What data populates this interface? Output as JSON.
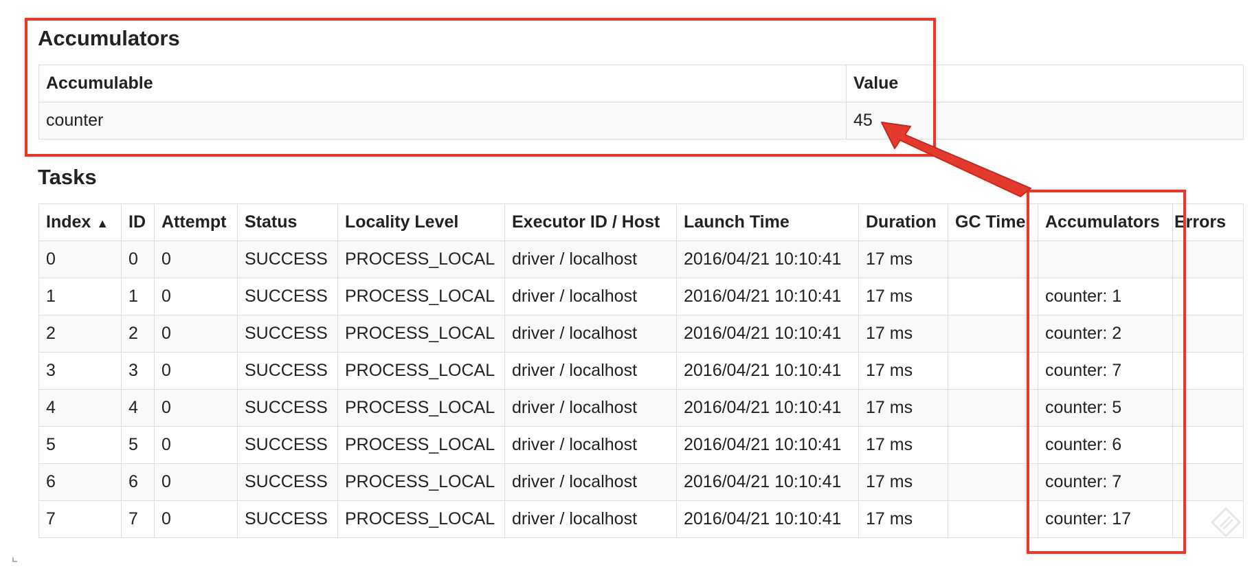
{
  "accumulators_section": {
    "title": "Accumulators",
    "columns": [
      "Accumulable",
      "Value"
    ],
    "rows": [
      {
        "name": "counter",
        "value": "45"
      }
    ]
  },
  "tasks_section": {
    "title": "Tasks",
    "sort_indicator": "▲",
    "columns": [
      "Index",
      "ID",
      "Attempt",
      "Status",
      "Locality Level",
      "Executor ID / Host",
      "Launch Time",
      "Duration",
      "GC Time",
      "Accumulators",
      "Errors"
    ],
    "rows": [
      {
        "index": "0",
        "id": "0",
        "attempt": "0",
        "status": "SUCCESS",
        "locality": "PROCESS_LOCAL",
        "executor": "driver / localhost",
        "launch": "2016/04/21 10:10:41",
        "duration": "17 ms",
        "gc": "",
        "accumulators": "",
        "errors": ""
      },
      {
        "index": "1",
        "id": "1",
        "attempt": "0",
        "status": "SUCCESS",
        "locality": "PROCESS_LOCAL",
        "executor": "driver / localhost",
        "launch": "2016/04/21 10:10:41",
        "duration": "17 ms",
        "gc": "",
        "accumulators": "counter: 1",
        "errors": ""
      },
      {
        "index": "2",
        "id": "2",
        "attempt": "0",
        "status": "SUCCESS",
        "locality": "PROCESS_LOCAL",
        "executor": "driver / localhost",
        "launch": "2016/04/21 10:10:41",
        "duration": "17 ms",
        "gc": "",
        "accumulators": "counter: 2",
        "errors": ""
      },
      {
        "index": "3",
        "id": "3",
        "attempt": "0",
        "status": "SUCCESS",
        "locality": "PROCESS_LOCAL",
        "executor": "driver / localhost",
        "launch": "2016/04/21 10:10:41",
        "duration": "17 ms",
        "gc": "",
        "accumulators": "counter: 7",
        "errors": ""
      },
      {
        "index": "4",
        "id": "4",
        "attempt": "0",
        "status": "SUCCESS",
        "locality": "PROCESS_LOCAL",
        "executor": "driver / localhost",
        "launch": "2016/04/21 10:10:41",
        "duration": "17 ms",
        "gc": "",
        "accumulators": "counter: 5",
        "errors": ""
      },
      {
        "index": "5",
        "id": "5",
        "attempt": "0",
        "status": "SUCCESS",
        "locality": "PROCESS_LOCAL",
        "executor": "driver / localhost",
        "launch": "2016/04/21 10:10:41",
        "duration": "17 ms",
        "gc": "",
        "accumulators": "counter: 6",
        "errors": ""
      },
      {
        "index": "6",
        "id": "6",
        "attempt": "0",
        "status": "SUCCESS",
        "locality": "PROCESS_LOCAL",
        "executor": "driver / localhost",
        "launch": "2016/04/21 10:10:41",
        "duration": "17 ms",
        "gc": "",
        "accumulators": "counter: 7",
        "errors": ""
      },
      {
        "index": "7",
        "id": "7",
        "attempt": "0",
        "status": "SUCCESS",
        "locality": "PROCESS_LOCAL",
        "executor": "driver / localhost",
        "launch": "2016/04/21 10:10:41",
        "duration": "17 ms",
        "gc": "",
        "accumulators": "counter: 17",
        "errors": ""
      }
    ]
  },
  "annotation": {
    "color": "#e23b2e",
    "arrow_icon": "arrow-icon",
    "watermark_icon": "pencil-watermark-icon"
  },
  "colors": {
    "border": "#dddddd",
    "stripe": "#f9f9f9",
    "text": "#222222"
  }
}
